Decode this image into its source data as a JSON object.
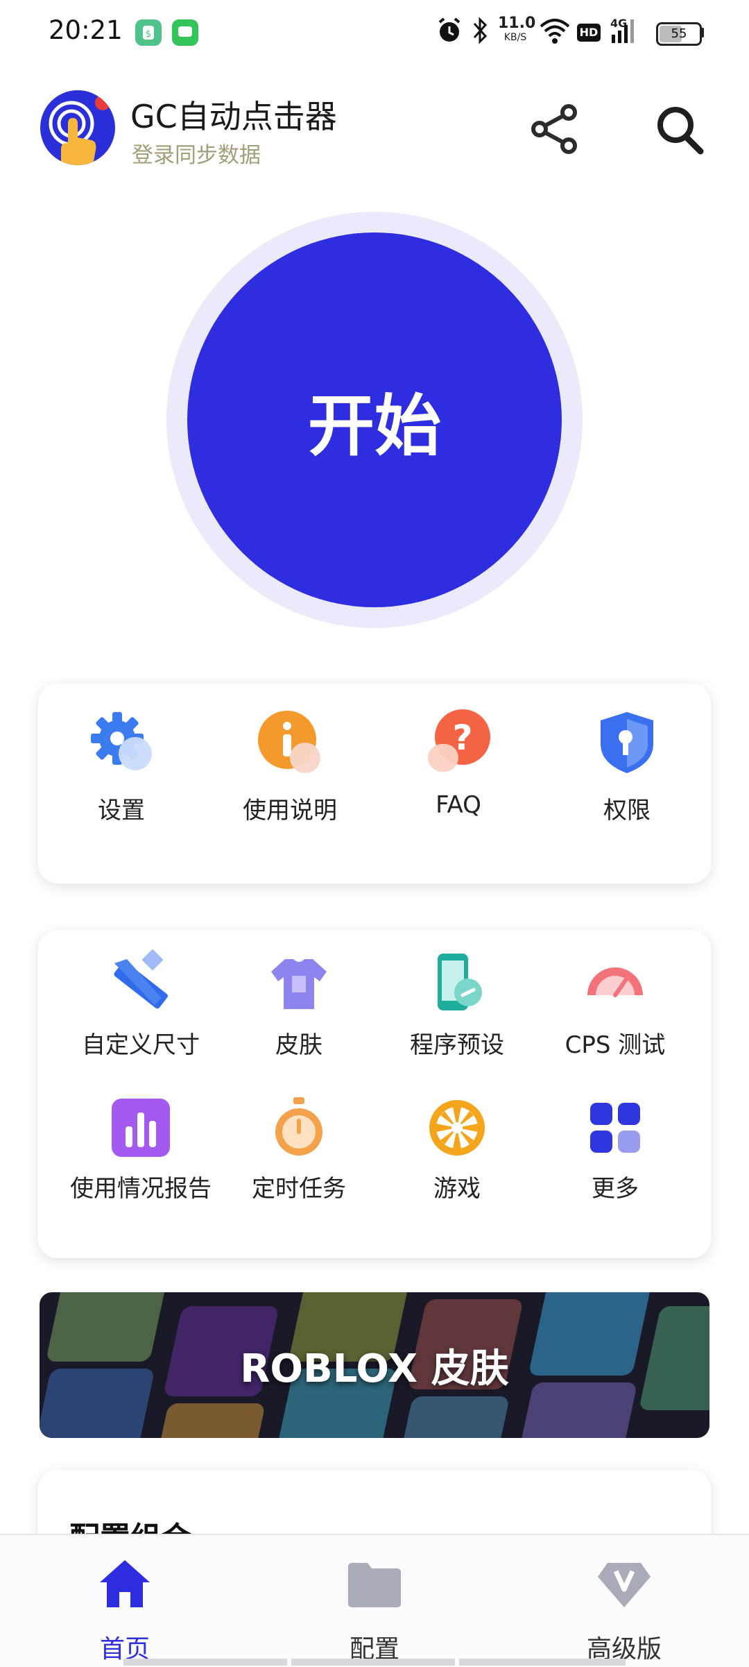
{
  "status_bar": {
    "time": "20:21",
    "net_speed_value": "11.0",
    "net_speed_unit": "KB/S",
    "hd_label": "HD",
    "signal_label": "4G",
    "battery": "55"
  },
  "header": {
    "title": "GC自动点击器",
    "subtitle": "登录同步数据"
  },
  "start_button": {
    "label": "开始"
  },
  "quick_actions": [
    {
      "label": "设置",
      "icon": "gear-icon"
    },
    {
      "label": "使用说明",
      "icon": "info-icon"
    },
    {
      "label": "FAQ",
      "icon": "question-icon"
    },
    {
      "label": "权限",
      "icon": "shield-key-icon"
    }
  ],
  "tools": [
    {
      "label": "自定义尺寸",
      "icon": "ruler-pencil-icon"
    },
    {
      "label": "皮肤",
      "icon": "tshirt-icon"
    },
    {
      "label": "程序预设",
      "icon": "phone-link-icon"
    },
    {
      "label": "CPS 测试",
      "icon": "speedometer-icon"
    },
    {
      "label": "使用情况报告",
      "icon": "bar-chart-icon"
    },
    {
      "label": "定时任务",
      "icon": "stopwatch-icon"
    },
    {
      "label": "游戏",
      "icon": "wheel-icon"
    },
    {
      "label": "更多",
      "icon": "grid-icon"
    }
  ],
  "banner": {
    "label": "ROBLOX 皮肤"
  },
  "config_card": {
    "title": "配置组合"
  },
  "bottom_nav": [
    {
      "label": "首页",
      "icon": "home-icon",
      "active": true
    },
    {
      "label": "配置",
      "icon": "folder-icon",
      "active": false
    },
    {
      "label": "高级版",
      "icon": "premium-diamond-icon",
      "active": false
    }
  ],
  "colors": {
    "primary": "#2e2ddf",
    "ring": "#ebeafb",
    "subtitle": "#a59d78",
    "nav_inactive": "#333333"
  }
}
